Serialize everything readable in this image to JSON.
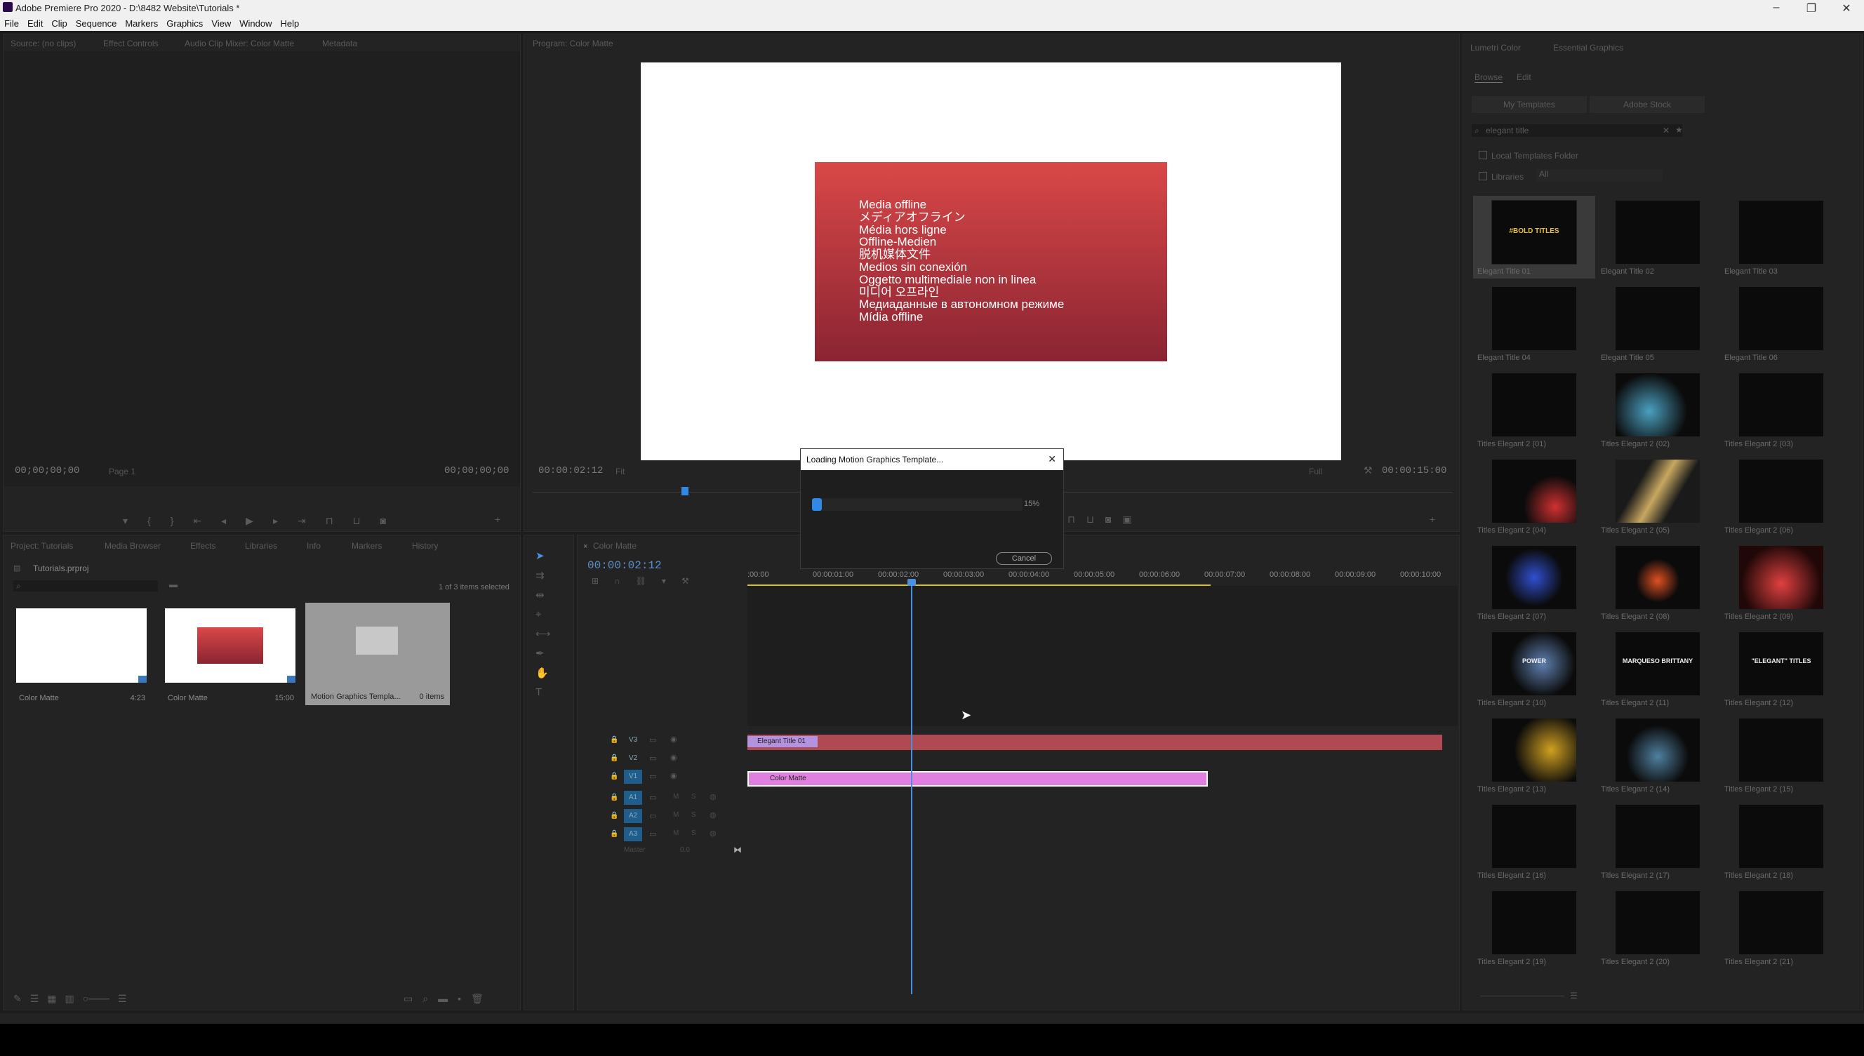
{
  "window": {
    "title": "Adobe Premiere Pro 2020 - D:\\8482 Website\\Tutorials *",
    "controls": [
      "–",
      "❐",
      "✕"
    ]
  },
  "menu": [
    "File",
    "Edit",
    "Clip",
    "Sequence",
    "Markers",
    "Graphics",
    "View",
    "Window",
    "Help"
  ],
  "source_panel": {
    "tabs": [
      "Source: (no clips)",
      "Effect Controls",
      "Audio Clip Mixer: Color Matte",
      "Metadata"
    ],
    "timecode_left": "00;00;00;00",
    "page": "Page 1",
    "timecode_right": "00;00;00;00"
  },
  "program_panel": {
    "tab": "Program: Color Matte",
    "offline_lines": [
      "Media offline",
      "メディアオフライン",
      "Média hors ligne",
      "Offline-Medien",
      "脱机媒体文件",
      "Medios sin conexión",
      "Oggetto multimediale non in linea",
      "미디어 오프라인",
      "Медиаданные в автономном режиме",
      "Mídia offline"
    ],
    "timecode_left": "00:00:02:12",
    "fit": "Fit",
    "full": "Full",
    "timecode_right": "00:00:15:00"
  },
  "dialog": {
    "title": "Loading Motion Graphics Template...",
    "progress_pct": 15,
    "progress_label": "15%",
    "cancel": "Cancel"
  },
  "project_panel": {
    "tabs": [
      "Project: Tutorials",
      "Media Browser",
      "Effects",
      "Libraries",
      "Info",
      "Markers",
      "History"
    ],
    "project_file": "Tutorials.prproj",
    "selection": "1 of 3 items selected",
    "items": [
      {
        "name": "Color Matte",
        "duration": "4:23"
      },
      {
        "name": "Color Matte",
        "duration": "15:00"
      },
      {
        "name": "Motion Graphics Templa...",
        "duration": "0 items"
      }
    ]
  },
  "timeline": {
    "tab": "Color Matte",
    "timecode": "00:00:02:12",
    "ruler": [
      ":00:00",
      "00:00:01:00",
      "00:00:02:00",
      "00:00:03:00",
      "00:00:04:00",
      "00:00:05:00",
      "00:00:06:00",
      "00:00:07:00",
      "00:00:08:00",
      "00:00:09:00",
      "00:00:10:00"
    ],
    "tracks": [
      "V3",
      "V2",
      "V1",
      "A1",
      "A2",
      "A3"
    ],
    "master": "Master",
    "master_val": "0.0",
    "clips": [
      {
        "name": "Elegant Title 01",
        "track": "V3"
      },
      {
        "name": "Color Matte",
        "track": "V1"
      }
    ]
  },
  "eg_panel": {
    "tabs": [
      "Lumetri Color",
      "Essential Graphics"
    ],
    "subtabs": [
      "Browse",
      "Edit"
    ],
    "buttons": [
      "My Templates",
      "Adobe Stock"
    ],
    "search": "elegant title",
    "checks": [
      "Local Templates Folder",
      "Libraries"
    ],
    "libraries_value": "All",
    "thumb_text": "#BOLD TITLES",
    "templates": [
      "Elegant Title 01",
      "Elegant Title 02",
      "Elegant Title 03",
      "Elegant Title 04",
      "Elegant Title 05",
      "Elegant Title 06",
      "Titles Elegant 2 (01)",
      "Titles Elegant 2 (02)",
      "Titles Elegant 2 (03)",
      "Titles Elegant 2 (04)",
      "Titles Elegant 2 (05)",
      "Titles Elegant 2 (06)",
      "Titles Elegant 2 (07)",
      "Titles Elegant 2 (08)",
      "Titles Elegant 2 (09)",
      "Titles Elegant 2 (10)",
      "Titles Elegant 2 (11)",
      "Titles Elegant 2 (12)",
      "Titles Elegant 2 (13)",
      "Titles Elegant 2 (14)",
      "Titles Elegant 2 (15)",
      "Titles Elegant 2 (16)",
      "Titles Elegant 2 (17)",
      "Titles Elegant 2 (18)",
      "Titles Elegant 2 (19)",
      "Titles Elegant 2 (20)",
      "Titles Elegant 2 (21)"
    ],
    "thumb_words": {
      "15": "POWER",
      "16": "MARQUESO BRITTANY",
      "17": "\"ELEGANT\" TITLES"
    }
  }
}
